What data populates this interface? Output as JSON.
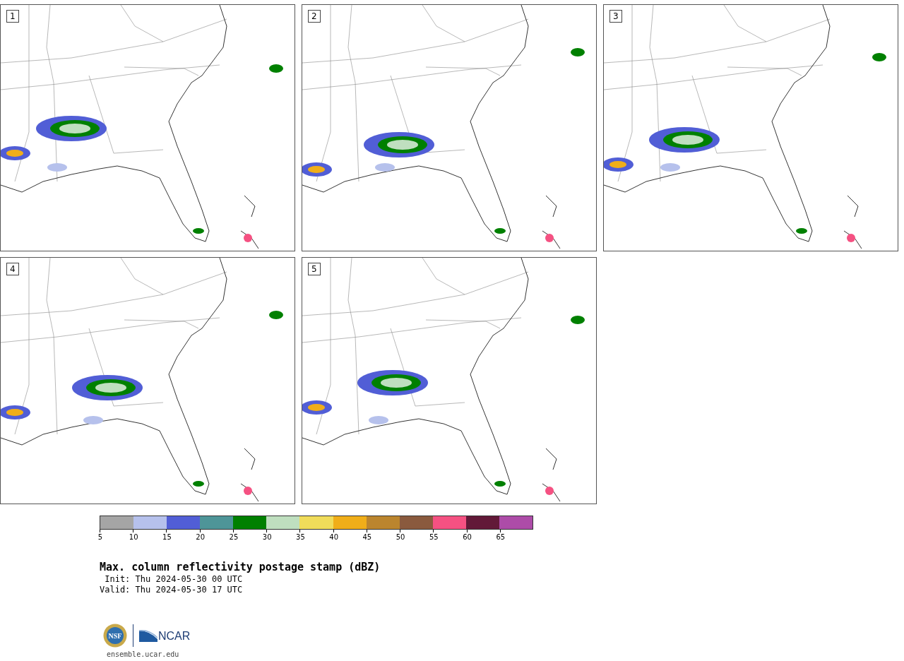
{
  "panels": [
    {
      "label": "1"
    },
    {
      "label": "2"
    },
    {
      "label": "3"
    },
    {
      "label": "4"
    },
    {
      "label": "5"
    }
  ],
  "colorbar": {
    "segments": [
      {
        "color": "#a5a5a5"
      },
      {
        "color": "#b6c1ec"
      },
      {
        "color": "#515ed6"
      },
      {
        "color": "#4e9598"
      },
      {
        "color": "#008000"
      },
      {
        "color": "#bfdfbf"
      },
      {
        "color": "#f0dc5a"
      },
      {
        "color": "#f0ae19"
      },
      {
        "color": "#bb852e"
      },
      {
        "color": "#8a5a3e"
      },
      {
        "color": "#f55182"
      },
      {
        "color": "#621938"
      },
      {
        "color": "#ad4ca8"
      }
    ],
    "ticks": [
      "5",
      "10",
      "15",
      "20",
      "25",
      "30",
      "35",
      "40",
      "45",
      "50",
      "55",
      "60",
      "65"
    ]
  },
  "title": "Max. column reflectivity postage stamp (dBZ)",
  "init": " Init: Thu 2024-05-30 00 UTC",
  "valid": "Valid: Thu 2024-05-30 17 UTC",
  "logo": {
    "nsf": "NSF",
    "ncar": "NCAR"
  },
  "url": "ensemble.ucar.edu"
}
